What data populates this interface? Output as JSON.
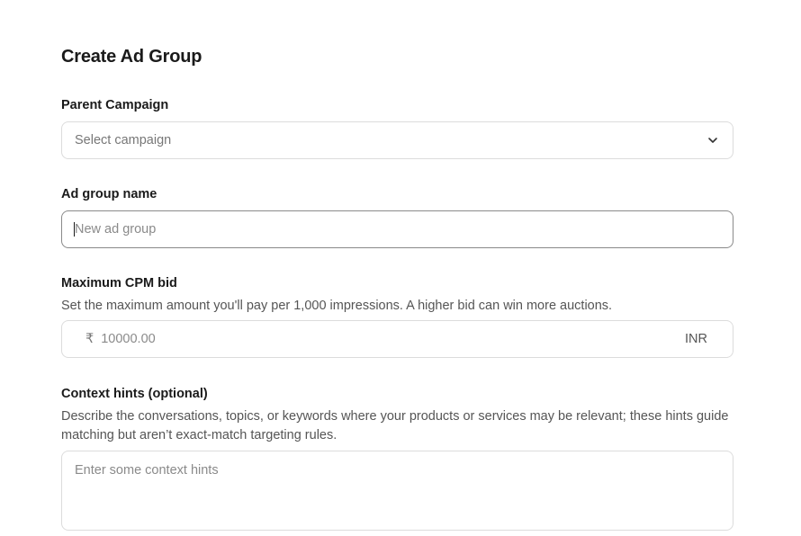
{
  "form": {
    "title": "Create Ad Group",
    "parent_campaign": {
      "label": "Parent Campaign",
      "selected_value": "Select campaign",
      "icon": "chevron-down-icon"
    },
    "ad_group_name": {
      "label": "Ad group name",
      "value": "",
      "placeholder": "New ad group"
    },
    "max_cpm_bid": {
      "label": "Maximum CPM bid",
      "help": "Set the maximum amount you'll pay per 1,000 impressions. A higher bid can win more auctions.",
      "currency_symbol": "₹",
      "value": "",
      "placeholder": "10000.00",
      "currency_code": "INR"
    },
    "context_hints": {
      "label": "Context hints (optional)",
      "help": "Describe the conversations, topics, or keywords where your products or services may be relevant; these hints guide matching but aren’t exact-match targeting rules.",
      "value": "",
      "placeholder": "Enter some context hints"
    }
  },
  "colors": {
    "text": "#1a1a1a",
    "muted": "#555555",
    "placeholder": "#8a8a8a",
    "border": "#dcdcdc",
    "focus_border": "#8a8a8a"
  }
}
